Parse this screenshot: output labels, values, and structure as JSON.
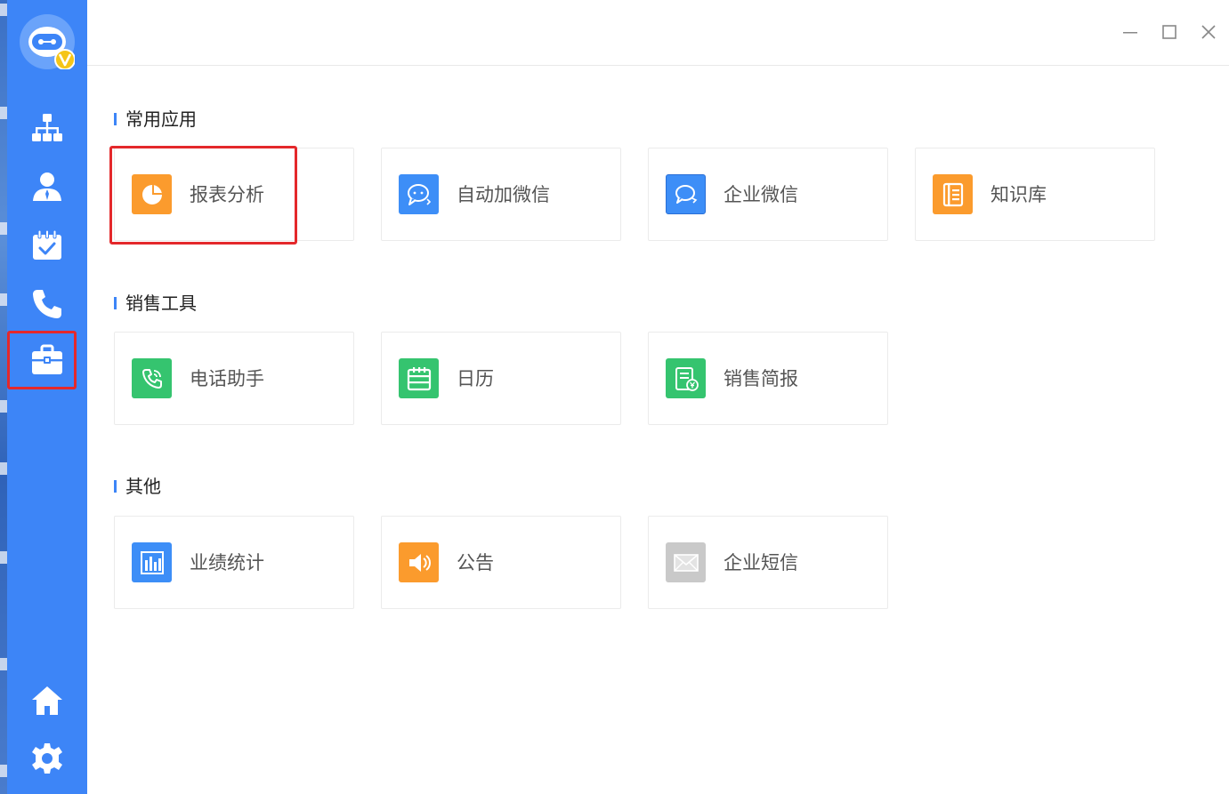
{
  "colors": {
    "sidebar": "#3d85f7",
    "accent": "#3d85f7",
    "highlight": "#e4282b",
    "orange": "#fb9b2d",
    "blue": "#3d8ef7",
    "green": "#35c46f",
    "gray": "#c9c9c9"
  },
  "sidebar": {
    "items": [
      {
        "icon": "org-chart-icon"
      },
      {
        "icon": "contact-icon"
      },
      {
        "icon": "calendar-check-icon"
      },
      {
        "icon": "phone-icon"
      },
      {
        "icon": "toolbox-icon",
        "active": true
      }
    ],
    "bottom": [
      {
        "icon": "home-icon"
      },
      {
        "icon": "settings-icon"
      }
    ]
  },
  "sections": [
    {
      "title": "常用应用",
      "apps": [
        {
          "label": "报表分析",
          "icon": "pie-chart-icon",
          "color": "orange"
        },
        {
          "label": "自动加微信",
          "icon": "chat-bubble-icon",
          "color": "blue"
        },
        {
          "label": "企业微信",
          "icon": "chat-bubble-icon",
          "color": "blue"
        },
        {
          "label": "知识库",
          "icon": "book-icon",
          "color": "orange"
        }
      ]
    },
    {
      "title": "销售工具",
      "apps": [
        {
          "label": "电话助手",
          "icon": "phone-call-icon",
          "color": "green"
        },
        {
          "label": "日历",
          "icon": "calendar-icon",
          "color": "green"
        },
        {
          "label": "销售简报",
          "icon": "report-yuan-icon",
          "color": "green"
        }
      ]
    },
    {
      "title": "其他",
      "apps": [
        {
          "label": "业绩统计",
          "icon": "bar-chart-icon",
          "color": "blue"
        },
        {
          "label": "公告",
          "icon": "speaker-icon",
          "color": "orange"
        },
        {
          "label": "企业短信",
          "icon": "envelope-icon",
          "color": "gray"
        }
      ]
    }
  ]
}
